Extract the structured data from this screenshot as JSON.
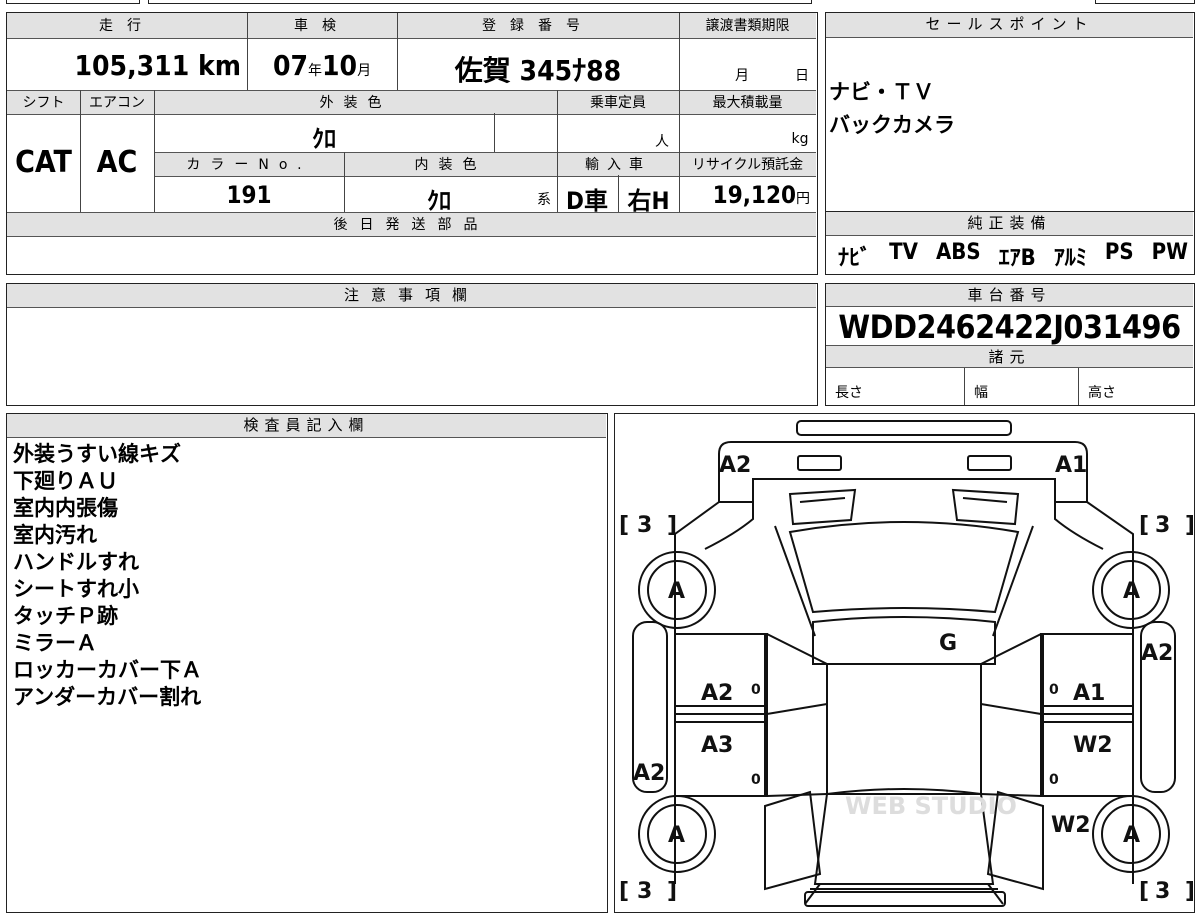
{
  "summary": {
    "mileage_label": "走行",
    "mileage_value": "105,311",
    "mileage_unit": "km",
    "shaken_label": "車検",
    "shaken_year": "07",
    "shaken_year_unit": "年",
    "shaken_month": "10",
    "shaken_month_unit": "月",
    "registration_label": "登録番号",
    "registration_value": "佐賀 345ﾅ88",
    "transfer_label": "譲渡書類期限",
    "transfer_month_unit": "月",
    "transfer_day_unit": "日",
    "shift_label": "シフト",
    "shift_value": "CAT",
    "aircon_label": "エアコン",
    "aircon_value": "AC",
    "exterior_color_label": "外装色",
    "exterior_color_value": "ｸﾛ",
    "capacity_label": "乗車定員",
    "capacity_unit": "人",
    "max_load_label": "最大積載量",
    "max_load_unit": "kg",
    "color_no_label": "カラーNo.",
    "color_no_value": "191",
    "interior_color_label": "内装色",
    "interior_color_value": "ｸﾛ",
    "interior_color_suffix": "系",
    "import_label": "輸入車",
    "import_dealer": "D車",
    "import_steering": "右H",
    "recycle_label": "リサイクル預託金",
    "recycle_value": "19,120",
    "recycle_unit": "円"
  },
  "sale_points": {
    "header": "セールスポイント",
    "items": [
      "ナビ・ＴＶ",
      "バックカメラ"
    ]
  },
  "later_parts": {
    "header": "後日発送部品"
  },
  "equipment": {
    "header": "純正装備",
    "items": [
      "ﾅﾋﾞ",
      "TV",
      "ABS",
      "ｴｱB",
      "ｱﾙﾐ",
      "PS",
      "PW"
    ]
  },
  "caution": {
    "header": "注意事項欄"
  },
  "chassis": {
    "header": "車台番号",
    "value": "WDD2462422J031496",
    "spec_header": "諸元",
    "length_label": "長さ",
    "width_label": "幅",
    "height_label": "高さ"
  },
  "inspector": {
    "header": "検査員記入欄",
    "notes": [
      "外装うすい線キズ",
      "下廻りＡＵ",
      "室内内張傷",
      "室内汚れ",
      "ハンドルすれ",
      "シートすれ小",
      "タッチＰ跡",
      "ミラーＡ",
      "ロッカーカバー下Ａ",
      "アンダーカバー割れ"
    ]
  },
  "diagram": {
    "front_left": "A2",
    "front_right": "A1",
    "tire_fl": "3",
    "tire_fr": "3",
    "tire_rl": "3",
    "tire_rr": "3",
    "wheel_fl": "A",
    "wheel_fr": "A",
    "wheel_rl": "A",
    "wheel_rr": "A",
    "roof": "G",
    "left_front_door": "A2",
    "left_rear_door": "A3",
    "left_rocker": "A2",
    "right_front_fender": "A2",
    "right_front_door": "A1",
    "right_rear_door": "W2",
    "right_rear_quarter": "W2",
    "left_front_door_num": "0",
    "left_rear_door_num": "0",
    "right_front_door_num": "0",
    "right_rear_door_num": "0",
    "watermark": "WEB STUDIO"
  }
}
